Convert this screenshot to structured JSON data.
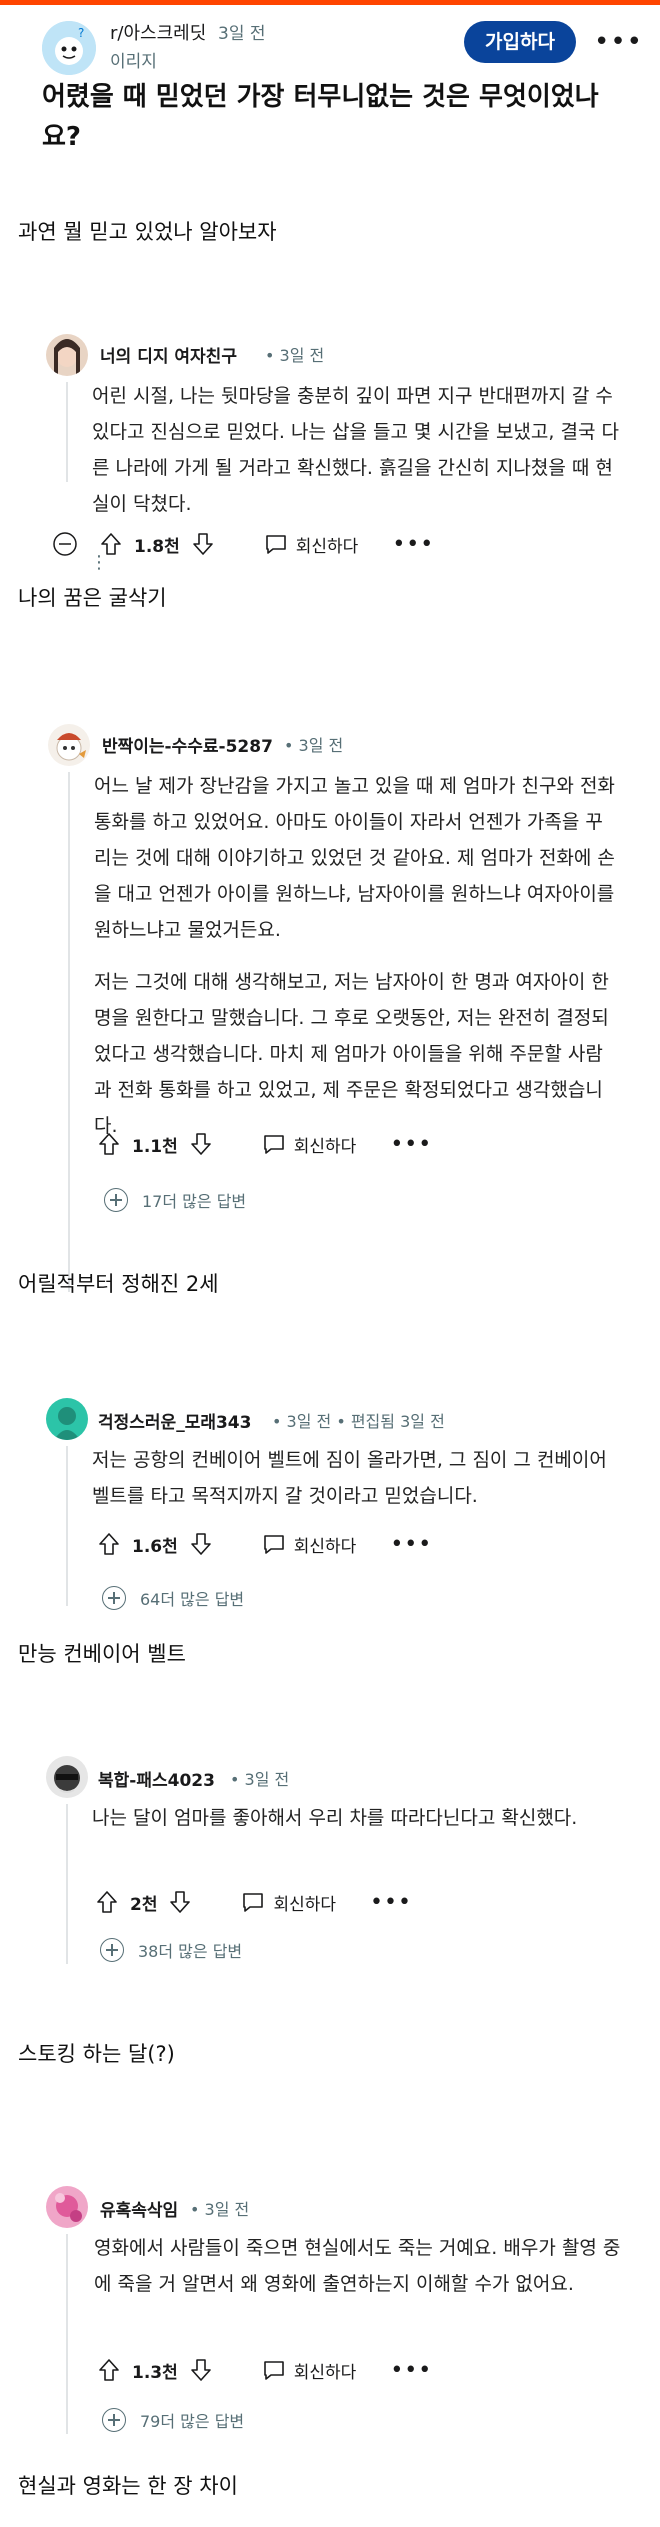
{
  "post": {
    "subreddit": "r/아스크레딧",
    "time": "3일 전",
    "user": "이리지",
    "join_label": "가입하다",
    "title": "어렸을 때 믿었던 가장 터무니없는 것은 무엇이었나요?"
  },
  "captions": [
    "과연 뭘 믿고 있었나 알아보자",
    "나의 꿈은 굴삭기",
    "어릴적부터 정해진 2세",
    "만능 컨베이어 벨트",
    "스토킹 하는 달(?)",
    "현실과 영화는 한 장 차이"
  ],
  "reply_label": "회신하다",
  "comments": [
    {
      "user": "너의 디지 여자친구",
      "meta": "• 3일 전",
      "body": [
        "어린 시절, 나는 뒷마당을 충분히 깊이 파면 지구 반대편까지 갈 수 있다고 진심으로 믿었다. 나는 삽을 들고 몇 시간을 보냈고, 결국 다른 나라에 가게 될 거라고 확신했다. 흙길을 간신히 지나쳤을 때 현실이 닥쳤다."
      ],
      "votes": "1.8천",
      "more": ""
    },
    {
      "user": "반짝이는-수수료-5287",
      "meta": "• 3일 전",
      "body": [
        "어느 날 제가 장난감을 가지고 놀고 있을 때 제 엄마가 친구와 전화 통화를 하고 있었어요. 아마도 아이들이 자라서 언젠가 가족을 꾸리는 것에 대해 이야기하고 있었던 것 같아요. 제 엄마가 전화에 손을 대고 언젠가 아이를 원하느냐, 남자아이를 원하느냐 여자아이를 원하느냐고 물었거든요.",
        "저는 그것에 대해 생각해보고, 저는 남자아이 한 명과 여자아이 한 명을 원한다고 말했습니다. 그 후로 오랫동안, 저는 완전히 결정되었다고 생각했습니다. 마치 제 엄마가 아이들을 위해 주문할 사람과 전화 통화를 하고 있었고, 제 주문은 확정되었다고 생각했습니다."
      ],
      "votes": "1.1천",
      "more": "17더 많은 답변"
    },
    {
      "user": "걱정스러운_모래343",
      "meta": "• 3일 전 • 편집됨 3일 전",
      "body": [
        "저는 공항의 컨베이어 벨트에 짐이 올라가면, 그 짐이 그 컨베이어 벨트를 타고 목적지까지 갈 것이라고 믿었습니다."
      ],
      "votes": "1.6천",
      "more": "64더 많은 답변"
    },
    {
      "user": "복합-패스4023",
      "meta": "• 3일 전",
      "body": [
        "나는 달이 엄마를 좋아해서 우리 차를 따라다닌다고 확신했다."
      ],
      "votes": "2천",
      "more": "38더 많은 답변"
    },
    {
      "user": "유혹속삭임",
      "meta": "• 3일 전",
      "body": [
        "영화에서 사람들이 죽으면 현실에서도 죽는 거예요. 배우가 촬영 중에 죽을 거 알면서 왜 영화에 출연하는지 이해할 수가 없어요."
      ],
      "votes": "1.3천",
      "more": "79더 많은 답변"
    }
  ],
  "colors": {
    "accent": "#ff4500",
    "join_button": "#0a449b",
    "meta_text": "#576f76"
  }
}
